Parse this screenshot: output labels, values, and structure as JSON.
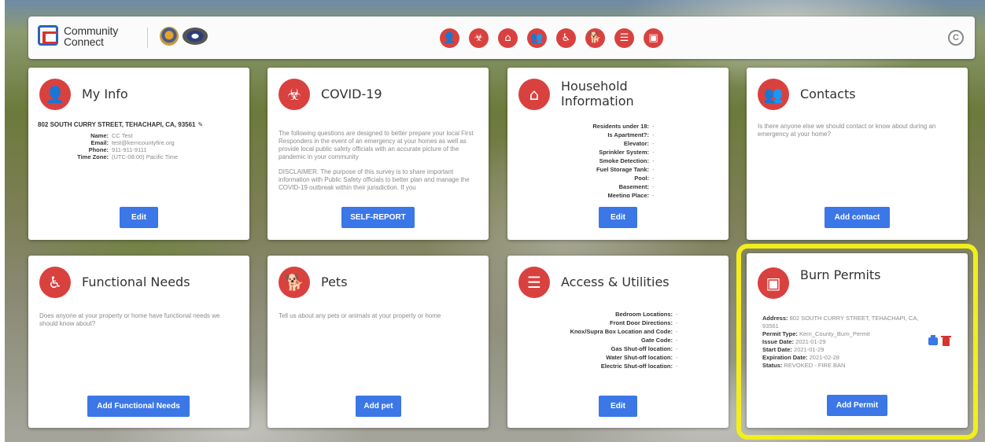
{
  "header": {
    "logo_text": "Community Connect",
    "nav_icons": [
      {
        "name": "my-info",
        "glyph": "👤"
      },
      {
        "name": "covid",
        "glyph": "☣"
      },
      {
        "name": "household",
        "glyph": "⌂"
      },
      {
        "name": "contacts",
        "glyph": "👥"
      },
      {
        "name": "functional-needs",
        "glyph": "♿"
      },
      {
        "name": "pets",
        "glyph": "🐕"
      },
      {
        "name": "access-utilities",
        "glyph": "☰"
      },
      {
        "name": "burn-permits",
        "glyph": "▣"
      }
    ],
    "profile_glyph": "C"
  },
  "my_info": {
    "title": "My Info",
    "address": "802 SOUTH CURRY STREET, TEHACHAPI, CA, 93561",
    "rows": [
      {
        "k": "Name:",
        "v": "CC Test"
      },
      {
        "k": "Email:",
        "v": "test@kerncountyfire.org"
      },
      {
        "k": "Phone:",
        "v": "911-911-9111"
      },
      {
        "k": "Time Zone:",
        "v": "(UTC-08:00) Pacific Time"
      }
    ],
    "button": "Edit"
  },
  "covid": {
    "title": "COVID-19",
    "para1": "The following questions are designed to better prepare your local First Responders in the event of an emergency at your homes as well as provide local public safety officials with an accurate picture of the pandemic in your community",
    "para2": "DISCLAIMER. The purpose of this survey is to share important information with Public Safety officials to better plan and manage the COVID-19 outbreak within their jurisdiction. If you",
    "button": "SELF-REPORT"
  },
  "household": {
    "title": "Household Information",
    "rows": [
      {
        "k": "Residents under 18:",
        "v": "-"
      },
      {
        "k": "Is Apartment?:",
        "v": "-"
      },
      {
        "k": "Elevator:",
        "v": "-"
      },
      {
        "k": "Sprinkler System:",
        "v": "-"
      },
      {
        "k": "Smoke Detection:",
        "v": "-"
      },
      {
        "k": "Fuel Storage Tank:",
        "v": "-"
      },
      {
        "k": "Pool:",
        "v": "-"
      },
      {
        "k": "Basement:",
        "v": "-"
      },
      {
        "k": "Meeting Place:",
        "v": "-"
      }
    ],
    "button": "Edit"
  },
  "contacts": {
    "title": "Contacts",
    "body": "Is there anyone else we should contact or know about during an emergency at your home?",
    "button": "Add contact"
  },
  "functional": {
    "title": "Functional Needs",
    "body": "Does anyone at your property or home have functional needs we should know about?",
    "button": "Add Functional Needs"
  },
  "pets": {
    "title": "Pets",
    "body": "Tell us about any pets or animals at your property or home",
    "button": "Add pet"
  },
  "access": {
    "title": "Access & Utilities",
    "rows": [
      {
        "k": "Bedroom Locations:",
        "v": "-"
      },
      {
        "k": "Front Door Directions:",
        "v": "-"
      },
      {
        "k": "Knox/Supra Box Location and Code:",
        "v": "-"
      },
      {
        "k": "Gate Code:",
        "v": "-"
      },
      {
        "k": "Gas Shut-off location:",
        "v": "-"
      },
      {
        "k": "Water Shut-off location:",
        "v": "-"
      },
      {
        "k": "Electric Shut-off location:",
        "v": "-"
      }
    ],
    "button": "Edit"
  },
  "burn": {
    "title": "Burn Permits",
    "address_k": "Address:",
    "address_v": "802 SOUTH CURRY STREET, TEHACHAPI, CA, 93561",
    "type_k": "Permit Type:",
    "type_v": "Kern_County_Burn_Permit",
    "issue_k": "Issue Date:",
    "issue_v": "2021-01-29",
    "start_k": "Start Date:",
    "start_v": "2021-01-29",
    "exp_k": "Expiration Date:",
    "exp_v": "2021-02-28",
    "status_k": "Status:",
    "status_v": "REVOKED - FIRE BAN",
    "button": "Add Permit"
  },
  "colors": {
    "accent_red": "#d9413f",
    "button_blue": "#3b77e6",
    "highlight_yellow": "#f1ee1c"
  }
}
